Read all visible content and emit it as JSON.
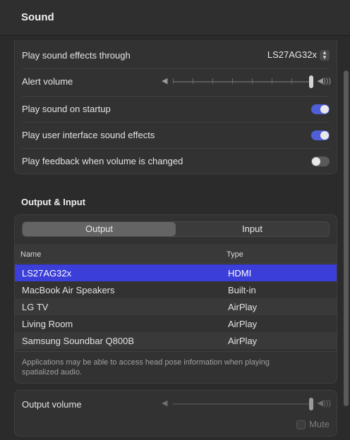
{
  "window": {
    "title": "Sound"
  },
  "sound_effects": {
    "play_through_label": "Play sound effects through",
    "play_through_value": "LS27AG32x",
    "alert_volume_label": "Alert volume",
    "alert_volume_level": 1.0,
    "startup_label": "Play sound on startup",
    "startup_on": true,
    "ui_effects_label": "Play user interface sound effects",
    "ui_effects_on": true,
    "feedback_label": "Play feedback when volume is changed",
    "feedback_on": false
  },
  "output_input": {
    "section_title": "Output & Input",
    "tabs": [
      {
        "label": "Output",
        "selected": true
      },
      {
        "label": "Input",
        "selected": false
      }
    ],
    "columns": {
      "name": "Name",
      "type": "Type"
    },
    "devices": [
      {
        "name": "LS27AG32x",
        "type": "HDMI",
        "selected": true
      },
      {
        "name": "MacBook Air Speakers",
        "type": "Built-in",
        "selected": false
      },
      {
        "name": "LG TV",
        "type": "AirPlay",
        "selected": false
      },
      {
        "name": "Living Room",
        "type": "AirPlay",
        "selected": false
      },
      {
        "name": "Samsung Soundbar Q800B",
        "type": "AirPlay",
        "selected": false
      }
    ],
    "note": "Applications may be able to access head pose information when playing spatialized audio."
  },
  "output_volume": {
    "label": "Output volume",
    "level": 1.0,
    "mute_label": "Mute",
    "muted": false
  },
  "colors": {
    "accent": "#3b3ed8",
    "toggle_on": "#4f5fd8",
    "background": "#2b2b2b"
  },
  "icons": {
    "volume_low": "speaker-low-icon",
    "volume_high": "speaker-high-icon",
    "popup": "chevron-updown-icon"
  }
}
